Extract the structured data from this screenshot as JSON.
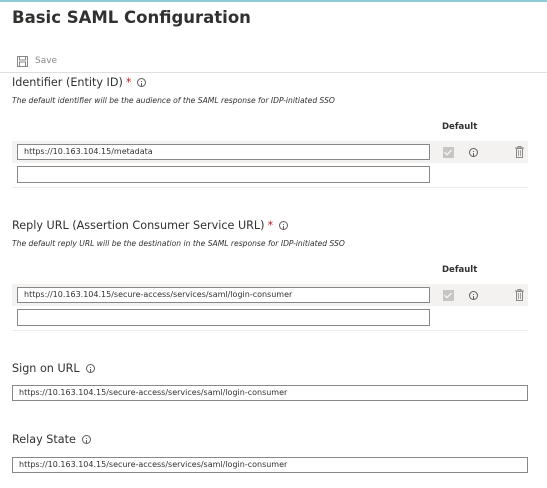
{
  "page": {
    "title": "Basic SAML Configuration"
  },
  "toolbar": {
    "save_label": "Save",
    "save_icon": "save-icon"
  },
  "identifier": {
    "label": "Identifier (Entity ID)",
    "required_mark": "*",
    "description": "The default identifier will be the audience of the SAML response for IDP-initiated SSO",
    "default_header": "Default",
    "values": [
      "https://10.163.104.15/metadata"
    ],
    "new_value": ""
  },
  "reply_url": {
    "label": "Reply URL (Assertion Consumer Service URL)",
    "required_mark": "*",
    "description": "The default reply URL will be the destination in the SAML response for IDP-initiated SSO",
    "default_header": "Default",
    "values": [
      "https://10.163.104.15/secure-access/services/saml/login-consumer"
    ],
    "new_value": ""
  },
  "sign_on_url": {
    "label": "Sign on URL",
    "value": "https://10.163.104.15/secure-access/services/saml/login-consumer"
  },
  "relay_state": {
    "label": "Relay State",
    "value": "https://10.163.104.15/secure-access/services/saml/login-consumer"
  },
  "colors": {
    "required": "#a4262c",
    "accent_line": "#8ec9d6",
    "row_background": "#f3f2f1",
    "disabled_text": "#8a8886"
  }
}
